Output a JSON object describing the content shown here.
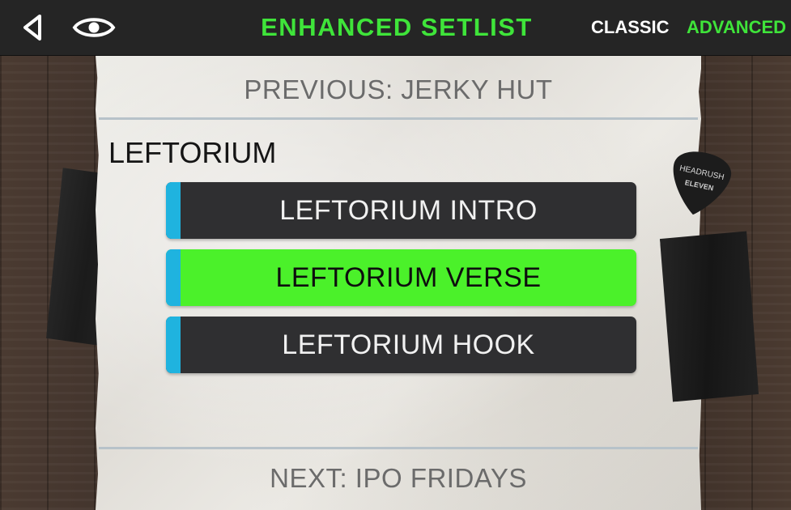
{
  "header": {
    "title": "ENHANCED SETLIST",
    "modes": {
      "classic": "CLASSIC",
      "advanced": "ADVANCED",
      "selected": "ADVANCED"
    },
    "icons": {
      "back": "back-triangle-icon",
      "view": "eye-icon"
    }
  },
  "setlist": {
    "previous": "PREVIOUS: JERKY HUT",
    "song": "LEFTORIUM",
    "sections": [
      {
        "label": "LEFTORIUM INTRO",
        "active": false
      },
      {
        "label": "LEFTORIUM VERSE",
        "active": true
      },
      {
        "label": "LEFTORIUM HOOK",
        "active": false
      }
    ],
    "next": "NEXT: IPO FRIDAYS"
  },
  "decor": {
    "pick_text_top": "HEADRUSH",
    "pick_text_bottom": "ELEVEN"
  },
  "colors": {
    "accent_green": "#3fe43a",
    "active_section": "#4bf12a",
    "section_bg": "#2f2f31",
    "section_marker": "#1fb3df",
    "topbar_bg": "#252525"
  }
}
